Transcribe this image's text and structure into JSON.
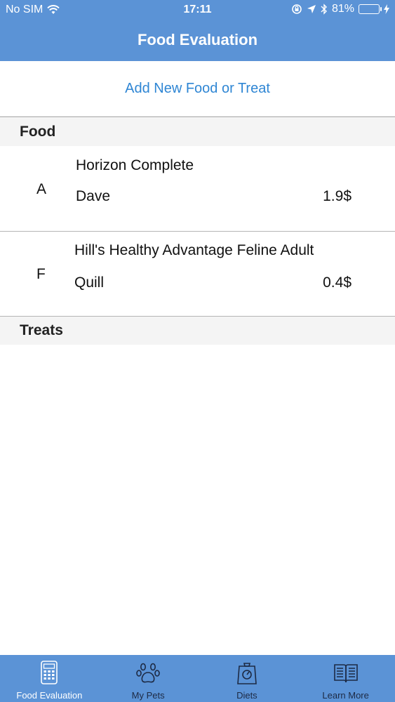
{
  "status_bar": {
    "carrier": "No SIM",
    "time": "17:11",
    "battery": "81%",
    "battery_level": 0.81
  },
  "nav": {
    "title": "Food Evaluation"
  },
  "add_button": {
    "label": "Add New Food or Treat"
  },
  "sections": {
    "food": "Food",
    "treats": "Treats"
  },
  "foods": [
    {
      "grade": "A",
      "name": "Horizon  Complete",
      "pet": "Dave",
      "price": "1.9$"
    },
    {
      "grade": "F",
      "name": "Hill's Healthy Advantage Feline Adult",
      "pet": "Quill",
      "price": "0.4$"
    }
  ],
  "tabs": [
    {
      "label": "Food Evaluation",
      "icon": "calculator-icon",
      "active": true
    },
    {
      "label": "My Pets",
      "icon": "paw-icon",
      "active": false
    },
    {
      "label": "Diets",
      "icon": "scale-icon",
      "active": false
    },
    {
      "label": "Learn More",
      "icon": "book-icon",
      "active": false
    }
  ],
  "colors": {
    "bar_blue": "#5b93d6",
    "link_blue": "#2f86d4",
    "battery_green": "#4cd964"
  }
}
